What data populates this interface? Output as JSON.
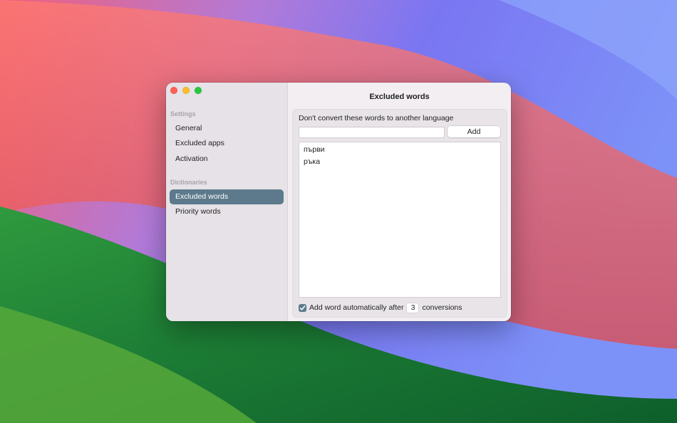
{
  "window": {
    "sidebar": {
      "sections": [
        {
          "header": "Settings",
          "items": [
            "General",
            "Excluded apps",
            "Activation"
          ]
        },
        {
          "header": "Dictionaries",
          "items": [
            "Excluded words",
            "Priority words"
          ]
        }
      ],
      "selected_item": "Excluded words"
    },
    "main": {
      "title": "Excluded words",
      "description": "Don't convert these words to another language",
      "input": {
        "value": "",
        "placeholder": ""
      },
      "add_button": "Add",
      "words": [
        "първи",
        "ръка"
      ],
      "auto_add": {
        "checked": true,
        "prefix": "Add word automatically after",
        "count": "3",
        "suffix": "conversions"
      }
    }
  },
  "colors": {
    "accent": "#5c7a8c",
    "close": "#fe5f57",
    "minimize": "#febc2e",
    "zoom": "#28c840"
  }
}
